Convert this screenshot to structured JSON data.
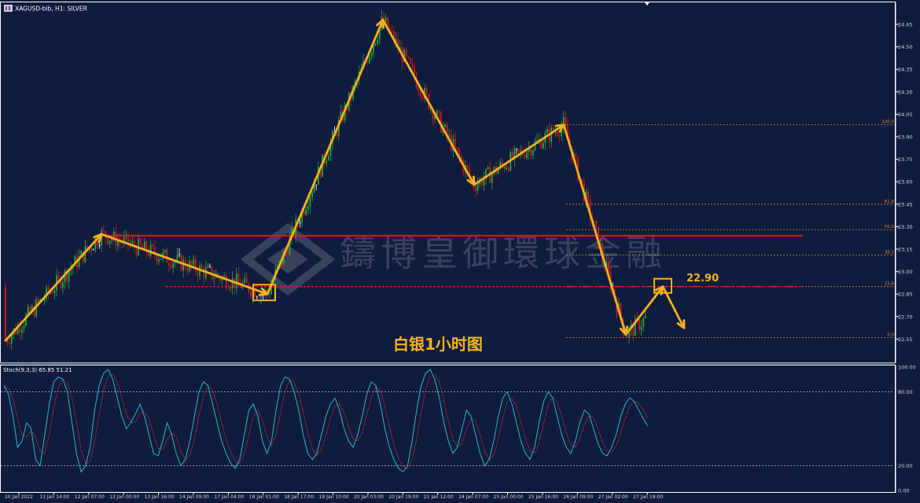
{
  "header": {
    "symbol_line": "XAGUSD-bib, H1:  SILVER"
  },
  "colors": {
    "background": "#0f1c3e",
    "bull": "#22a83a",
    "bear": "#d01818",
    "doji": "#ffffff",
    "zigzag": "#f5b21e",
    "resistance": "#e01818",
    "fib": "#e38a3a",
    "stoch_main": "#26b8c8",
    "stoch_signal": "#e03030",
    "axis_text": "#d0d4dc",
    "grid_text": "#c8c8c8"
  },
  "price_axis": {
    "labels": [
      "24.65",
      "24.50",
      "24.35",
      "24.20",
      "24.05",
      "23.90",
      "23.75",
      "23.60",
      "23.45",
      "23.30",
      "23.15",
      "23.00",
      "22.85",
      "22.70",
      "22.55"
    ]
  },
  "time_axis": {
    "labels": [
      "10 Jan 2022",
      "11 Jan 14:00",
      "12 Jan 07:00",
      "13 Jan 00:00",
      "13 Jan 16:00",
      "14 Jan 09:00",
      "17 Jan 04:00",
      "18 Jan 01:00",
      "18 Jan 17:00",
      "19 Jan 10:00",
      "20 Jan 03:00",
      "20 Jan 19:00",
      "21 Jan 12:00",
      "24 Jan 07:00",
      "25 Jan 00:00",
      "25 Jan 16:00",
      "26 Jan 09:00",
      "27 Jan 02:00",
      "27 Jan 18:00"
    ]
  },
  "fibonacci": {
    "levels": [
      "100.0",
      "61.8",
      "50.0",
      "38.2",
      "23.6",
      "0.0"
    ]
  },
  "annotations": {
    "chart_title": "白银1小时图",
    "target_price": "22.90",
    "watermark": "鑄博皇御環球金融"
  },
  "stochastic": {
    "label": "Stoch(9,3,3) 65.85 51.21",
    "axis_labels": [
      "100.00",
      "80.00",
      "20.00",
      "0.00"
    ]
  },
  "chart_data": [
    {
      "type": "line",
      "title": "XAGUSD-bib, H1: SILVER",
      "xlabel": "",
      "ylabel": "",
      "ylim": [
        22.5,
        24.72
      ],
      "series": [
        {
          "x": [
            "10 Jan 2022",
            "12 Jan 07:00",
            "18 Jan 01:00",
            "20 Jan 03:00",
            "24 Jan 07:00",
            "26 Jan 09:00",
            "27 Jan 02:00",
            "27 Jan 18:00"
          ],
          "values": [
            22.54,
            23.25,
            22.85,
            24.68,
            23.58,
            23.98,
            22.58,
            22.9
          ]
        }
      ],
      "fib_levels_price": {
        "100.0": 23.98,
        "61.8": 23.45,
        "50.0": 23.28,
        "38.2": 23.11,
        "23.6": 22.9,
        "0.0": 22.56
      },
      "resistance_price": 23.24,
      "support_price": 22.9,
      "grid": false
    },
    {
      "type": "line",
      "title": "Stoch(9,3,3)",
      "ylim": [
        0,
        100
      ],
      "levels": [
        80,
        20
      ],
      "series": [
        {
          "values": [
            85,
            78,
            60,
            35,
            40,
            55,
            50,
            25,
            20,
            45,
            70,
            88,
            92,
            90,
            80,
            55,
            30,
            15,
            20,
            35,
            65,
            85,
            95,
            98,
            90,
            75,
            60,
            50,
            55,
            62,
            70,
            60,
            45,
            30,
            28,
            40,
            55,
            45,
            30,
            20,
            25,
            40,
            60,
            80,
            88,
            85,
            70,
            55,
            40,
            30,
            22,
            18,
            25,
            45,
            65,
            70,
            60,
            40,
            30,
            40,
            65,
            85,
            92,
            90,
            80,
            65,
            45,
            30,
            25,
            30,
            45,
            60,
            70,
            75,
            65,
            50,
            40,
            35,
            45,
            60,
            78,
            88,
            85,
            70,
            50,
            35,
            25,
            18,
            15,
            20,
            40,
            65,
            85,
            95,
            98,
            90,
            75,
            55,
            40,
            30,
            35,
            50,
            65,
            60,
            45,
            30,
            20,
            25,
            40,
            60,
            75,
            80,
            70,
            55,
            40,
            30,
            25,
            35,
            55,
            72,
            80,
            75,
            60,
            45,
            35,
            30,
            40,
            55,
            65,
            62,
            50,
            38,
            30,
            28,
            35,
            45,
            60,
            70,
            75,
            72,
            65,
            58,
            52
          ]
        }
      ]
    }
  ]
}
